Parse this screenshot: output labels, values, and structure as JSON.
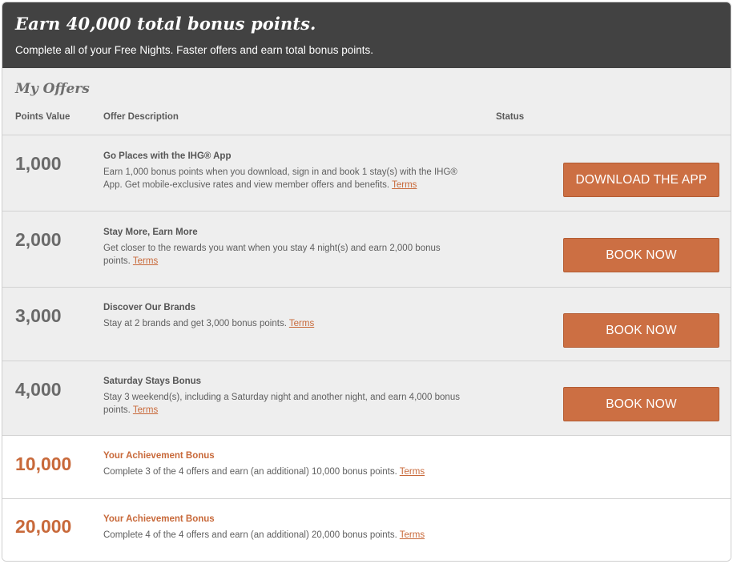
{
  "banner": {
    "title": "Earn 40,000 total bonus points.",
    "subtitle": "Complete all of your Free Nights. Faster offers and earn total bonus points."
  },
  "offers": {
    "title": "My Offers",
    "columns": {
      "points": "Points Value",
      "description": "Offer Description",
      "status": "Status"
    },
    "rows": [
      {
        "points": "1,000",
        "title": "Go Places with the IHG® App",
        "body": "Earn 1,000 bonus points when you download, sign in and book 1 stay(s) with the IHG® App. Get mobile-exclusive rates and view member offers and benefits.",
        "terms": "Terms",
        "button": "DOWNLOAD THE APP"
      },
      {
        "points": "2,000",
        "title": "Stay More, Earn More",
        "body": "Get closer to the rewards you want when you stay 4 night(s) and earn 2,000 bonus points.",
        "terms": "Terms",
        "button": "BOOK NOW"
      },
      {
        "points": "3,000",
        "title": "Discover Our Brands",
        "body": "Stay at 2 brands and get 3,000 bonus points.",
        "terms": "Terms",
        "button": "BOOK NOW"
      },
      {
        "points": "4,000",
        "title": "Saturday Stays Bonus",
        "body": "Stay 3 weekend(s), including a Saturday night and another night, and earn 4,000 bonus points.",
        "terms": "Terms",
        "button": "BOOK NOW"
      }
    ],
    "achievements": [
      {
        "points": "10,000",
        "title": "Your Achievement Bonus",
        "body": "Complete 3 of the 4 offers and earn (an additional) 10,000 bonus points.",
        "terms": "Terms"
      },
      {
        "points": "20,000",
        "title": "Your Achievement Bonus",
        "body": "Complete 4 of the 4 offers and earn (an additional) 20,000 bonus points.",
        "terms": "Terms"
      }
    ]
  },
  "colors": {
    "banner_bg": "#424242",
    "accent": "#cc6f43",
    "row_gray": "#eeeeee"
  }
}
